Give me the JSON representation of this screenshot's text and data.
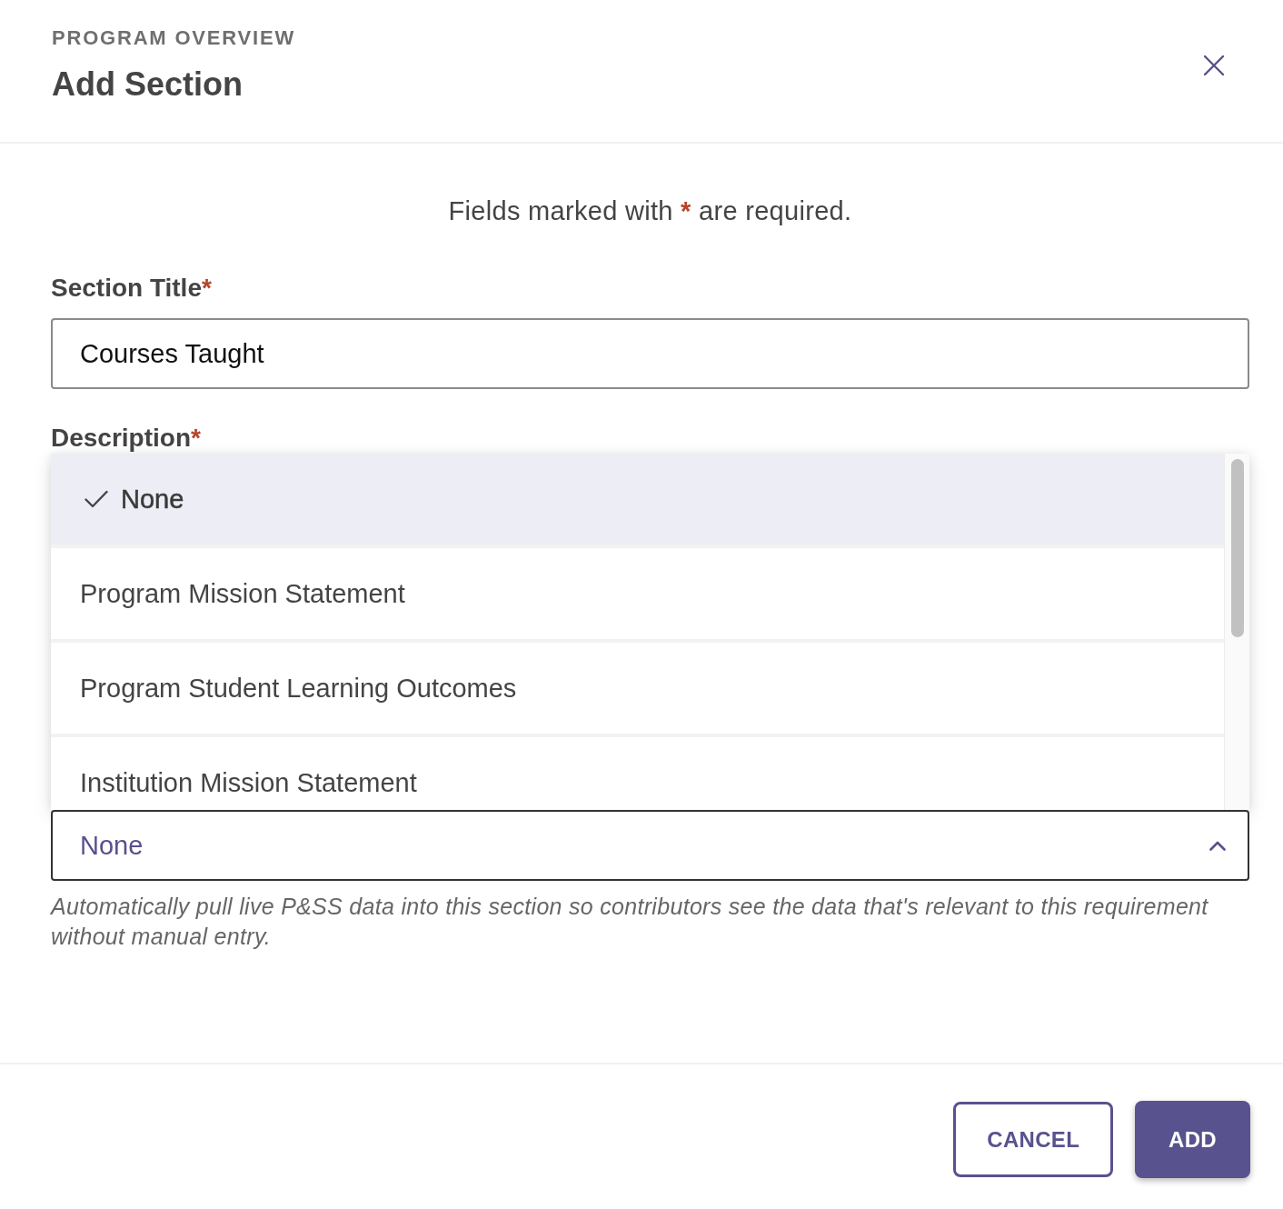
{
  "header": {
    "eyebrow": "PROGRAM OVERVIEW",
    "title": "Add Section"
  },
  "required_note": {
    "before": "Fields marked with",
    "mark": "*",
    "after": "are required."
  },
  "fields": [
    {
      "kind": "text",
      "label": "Section Title",
      "required_mark": "*",
      "value": "Courses Taught"
    },
    {
      "kind": "label",
      "label": "Description",
      "required_mark": "*"
    },
    {
      "kind": "select",
      "value": "None",
      "expanded": true,
      "options": [
        {
          "label": "None",
          "selected": true
        },
        {
          "label": "Program Mission Statement",
          "selected": false
        },
        {
          "label": "Program Student Learning Outcomes",
          "selected": false
        },
        {
          "label": "Institution Mission Statement",
          "selected": false
        }
      ],
      "help": "Automatically pull live P&SS data into this section so contributors see the data that's relevant to this requirement without manual entry."
    }
  ],
  "buttons": [
    {
      "label": "CANCEL",
      "kind": "secondary"
    },
    {
      "label": "ADD",
      "kind": "primary"
    }
  ]
}
